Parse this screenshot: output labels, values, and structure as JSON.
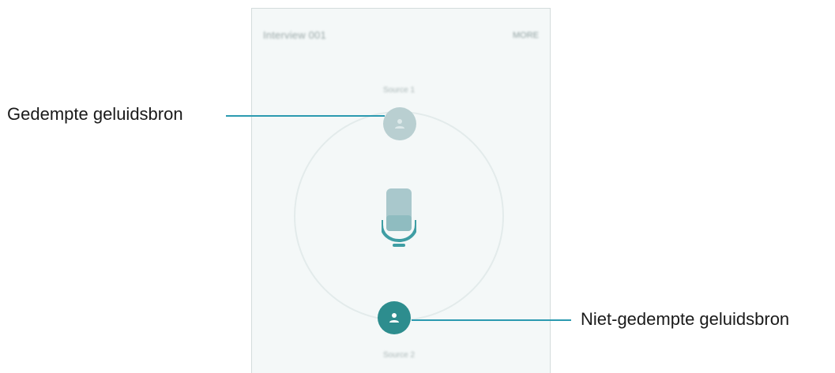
{
  "screen": {
    "title": "Interview 001",
    "action_label": "MORE",
    "sources": {
      "top_label": "Source 1",
      "bottom_label": "Source 2"
    }
  },
  "annotations": {
    "muted_source_label": "Gedempte geluidsbron",
    "unmuted_source_label": "Niet-gedempte geluidsbron"
  },
  "colors": {
    "accent_line": "#2b9ab0",
    "active_node": "#2d8d8e",
    "muted_node": "#b9cfd1",
    "mic_body": "#a9c8cc",
    "mic_base": "#3f9ea4"
  }
}
